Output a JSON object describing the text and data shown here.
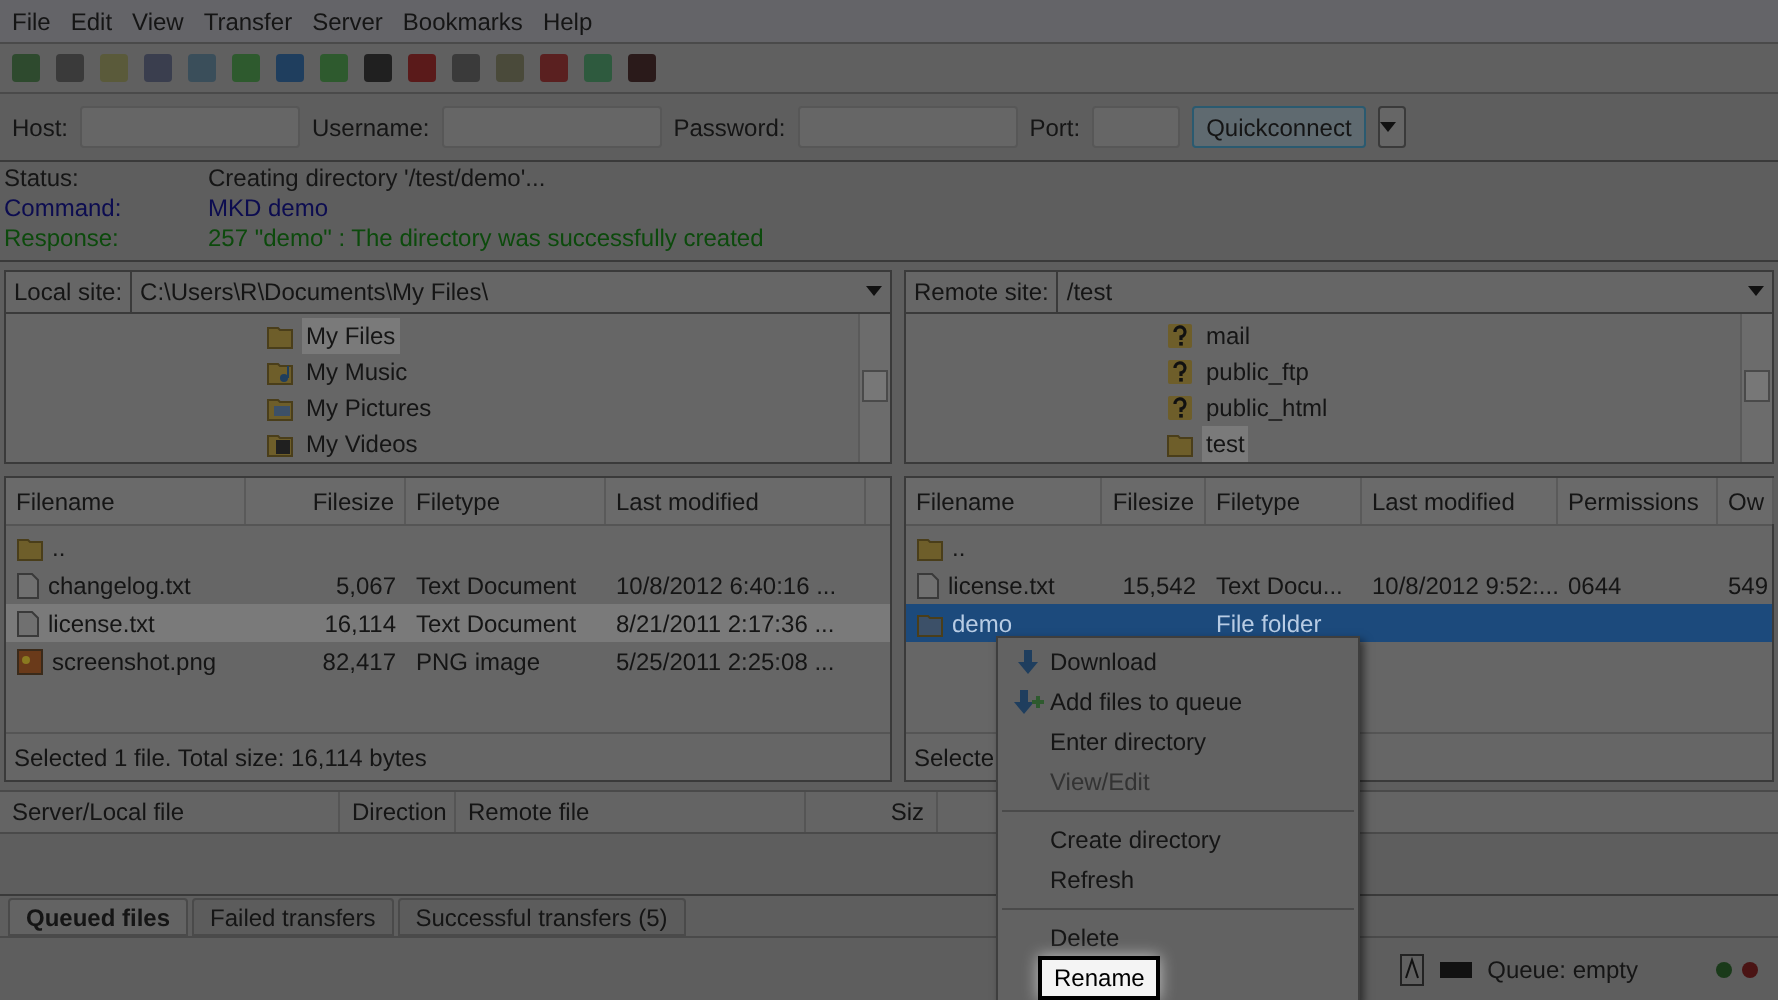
{
  "menu_bar": [
    "File",
    "Edit",
    "View",
    "Transfer",
    "Server",
    "Bookmarks",
    "Help"
  ],
  "quickconnect": {
    "fields": [
      {
        "label": "Host:"
      },
      {
        "label": "Username:"
      },
      {
        "label": "Password:"
      },
      {
        "label": "Port:"
      }
    ],
    "button": "Quickconnect"
  },
  "log": [
    {
      "kind": "status",
      "label": "Status:",
      "text": "Creating directory '/test/demo'..."
    },
    {
      "kind": "command",
      "label": "Command:",
      "text": "MKD demo"
    },
    {
      "kind": "response",
      "label": "Response:",
      "text": "257 \"demo\" : The directory was successfully created"
    }
  ],
  "local": {
    "site_label": "Local site:",
    "path": "C:\\Users\\R\\Documents\\My Files\\",
    "tree": [
      {
        "name": "My Files",
        "kind": "folder",
        "selected": true
      },
      {
        "name": "My Music",
        "kind": "music",
        "selected": false
      },
      {
        "name": "My Pictures",
        "kind": "pictures",
        "selected": false
      },
      {
        "name": "My Videos",
        "kind": "videos",
        "selected": false
      }
    ],
    "columns": [
      "Filename",
      "Filesize",
      "Filetype",
      "Last modified"
    ],
    "rows": [
      {
        "kind": "folder",
        "selected": false,
        "cells": [
          ".."
        ]
      },
      {
        "kind": "text",
        "selected": false,
        "cells": [
          "changelog.txt",
          "5,067",
          "Text Document",
          "10/8/2012 6:40:16 ..."
        ]
      },
      {
        "kind": "text",
        "selected": true,
        "cells": [
          "license.txt",
          "16,114",
          "Text Document",
          "8/21/2011 2:17:36 ..."
        ]
      },
      {
        "kind": "image",
        "selected": false,
        "cells": [
          "screenshot.png",
          "82,417",
          "PNG image",
          "5/25/2011 2:25:08 ..."
        ]
      }
    ],
    "status": "Selected 1 file. Total size: 16,114 bytes"
  },
  "remote": {
    "site_label": "Remote site:",
    "path": "/test",
    "tree": [
      {
        "name": "mail",
        "kind": "unknown",
        "selected": false
      },
      {
        "name": "public_ftp",
        "kind": "unknown",
        "selected": false
      },
      {
        "name": "public_html",
        "kind": "unknown",
        "selected": false
      },
      {
        "name": "test",
        "kind": "folder",
        "selected": true
      }
    ],
    "columns": [
      "Filename",
      "Filesize",
      "Filetype",
      "Last modified",
      "Permissions",
      "Ow"
    ],
    "rows": [
      {
        "kind": "folder",
        "selected": false,
        "cells": [
          ".."
        ]
      },
      {
        "kind": "text",
        "selected": false,
        "cells": [
          "license.txt",
          "15,542",
          "Text Docu...",
          "10/8/2012 9:52:...",
          "0644",
          "549"
        ]
      },
      {
        "kind": "folder",
        "selected": true,
        "cells": [
          "demo",
          "",
          "File folder"
        ]
      }
    ],
    "status": "Selecte"
  },
  "context_menu": [
    {
      "kind": "item",
      "label": "Download",
      "disabled": false,
      "highlighted": false
    },
    {
      "kind": "item",
      "label": "Add files to queue",
      "disabled": false,
      "highlighted": false
    },
    {
      "kind": "item",
      "label": "Enter directory",
      "disabled": false,
      "highlighted": false
    },
    {
      "kind": "item",
      "label": "View/Edit",
      "disabled": true,
      "highlighted": false
    },
    {
      "kind": "separator"
    },
    {
      "kind": "item",
      "label": "Create directory",
      "disabled": false,
      "highlighted": false
    },
    {
      "kind": "item",
      "label": "Refresh",
      "disabled": false,
      "highlighted": false
    },
    {
      "kind": "separator"
    },
    {
      "kind": "item",
      "label": "Delete",
      "disabled": false,
      "highlighted": false
    },
    {
      "kind": "item",
      "label": "Rename",
      "disabled": false,
      "highlighted": true
    }
  ],
  "queue": {
    "columns": [
      "Server/Local file",
      "Direction",
      "Remote file",
      "Siz"
    ],
    "tabs": [
      {
        "label": "Queued files",
        "selected": true
      },
      {
        "label": "Failed transfers",
        "selected": false
      },
      {
        "label": "Successful transfers (5)",
        "selected": false
      }
    ]
  },
  "status_bar": {
    "queue": "Queue: empty"
  }
}
